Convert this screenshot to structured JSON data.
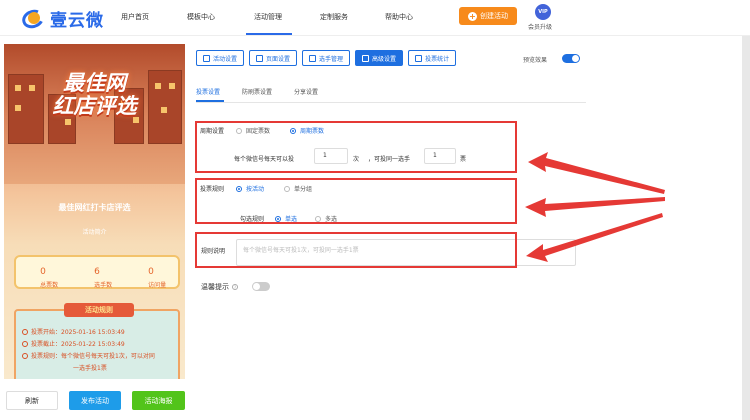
{
  "brand": {
    "name": "壹云微"
  },
  "nav": {
    "items": [
      "用户首页",
      "模板中心",
      "活动管理",
      "定制服务",
      "帮助中心"
    ],
    "create_label": "创建活动",
    "vip_label": "VIP",
    "upgrade_label": "会员升级"
  },
  "preview": {
    "hero_line1": "最佳网",
    "hero_line2": "红店评选",
    "activity_title": "最佳网红打卡店评选",
    "activity_sub": "活动简介",
    "stats": [
      {
        "value": "0",
        "label": "总票数"
      },
      {
        "value": "6",
        "label": "选手数"
      },
      {
        "value": "0",
        "label": "访问量"
      }
    ],
    "rules_title": "活动规则",
    "rules": [
      "投票开始：2025-01-16 15:03:49",
      "投票截止：2025-01-22 15:03:49",
      "投票规则：每个微信号每天可投1次，可以对同",
      "一选手投1票"
    ],
    "tabs": [
      "介绍",
      "投票",
      "排行",
      "报名"
    ]
  },
  "bottom_buttons": {
    "refresh": "刷新",
    "publish": "发布活动",
    "poster": "活动海报"
  },
  "toolbar": {
    "buttons": [
      "活动设置",
      "页面设置",
      "选手管理",
      "高级设置",
      "投票统计"
    ],
    "active_index": 3,
    "preview_label": "预览效果",
    "preview_on": true
  },
  "subtabs": {
    "items": [
      "投票设置",
      "防刷票设置",
      "分享设置"
    ],
    "active_index": 0
  },
  "form": {
    "cycle_label": "周期设置",
    "cycle_options": [
      "固定票数",
      "周期票数"
    ],
    "cycle_selected": 1,
    "daily_text1": "每个微信号每天可以投",
    "daily_value": "1",
    "daily_text2": "次",
    "daily_text3": "，可投同一选手",
    "same_value": "1",
    "daily_text4": "票",
    "vote_rule_label": "投票规则",
    "vote_rule_options": [
      "按活动",
      "单分组"
    ],
    "vote_rule_selected": 0,
    "select_rule_label": "勾选规则",
    "select_rule_options": [
      "单选",
      "多选"
    ],
    "select_rule_selected": 0,
    "rule_desc_label": "规则说明",
    "rule_desc_placeholder": "每个微信号每天可投1次，可投同一选手1票",
    "tip_label": "温馨提示",
    "tip_help": "?",
    "tip_on": false
  },
  "colors": {
    "primary": "#1e6fe0",
    "orange": "#f78a1b",
    "green": "#52c41a",
    "highlight": "#e53935"
  }
}
